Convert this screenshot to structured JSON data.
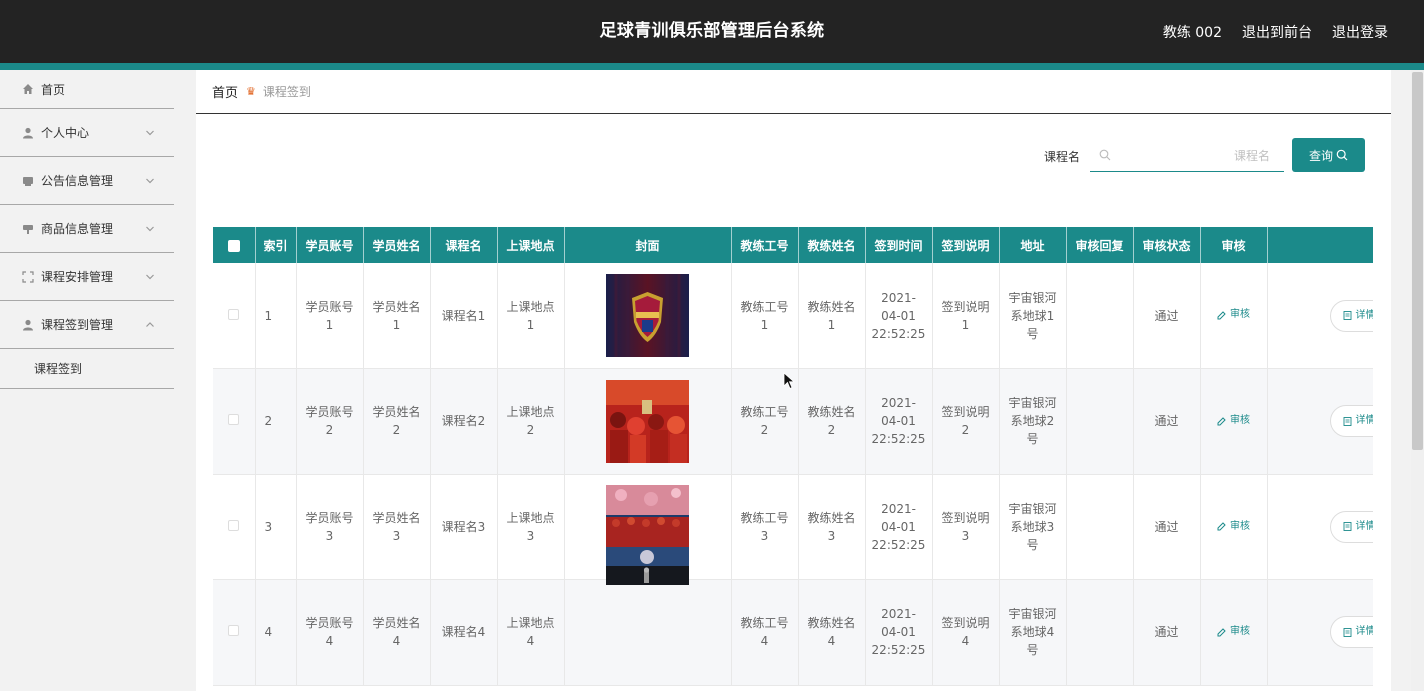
{
  "header": {
    "title": "足球青训俱乐部管理后台系统",
    "user": "教练 002",
    "to_front": "退出到前台",
    "logout": "退出登录"
  },
  "sidebar": {
    "home": "首页",
    "items": [
      {
        "label": "个人中心"
      },
      {
        "label": "公告信息管理"
      },
      {
        "label": "商品信息管理"
      },
      {
        "label": "课程安排管理"
      },
      {
        "label": "课程签到管理"
      }
    ],
    "sub_item": "课程签到"
  },
  "breadcrumb": {
    "home": "首页",
    "current": "课程签到"
  },
  "search": {
    "label": "课程名",
    "placeholder": "课程名",
    "button": "查询"
  },
  "table": {
    "headers": [
      "索引",
      "学员账号",
      "学员姓名",
      "课程名",
      "上课地点",
      "封面",
      "教练工号",
      "教练姓名",
      "签到时间",
      "签到说明",
      "地址",
      "审核回复",
      "审核状态",
      "审核"
    ],
    "audit_label": "审核",
    "detail_label": "详情",
    "rows": [
      {
        "idx": "1",
        "account": "学员账号1",
        "name": "学员姓名1",
        "course": "课程名1",
        "place": "上课地点1",
        "coach_id": "教练工号1",
        "coach_name": "教练姓名1",
        "time": "2021-04-01 22:52:25",
        "note": "签到说明1",
        "addr": "宇宙银河系地球1号",
        "reply": "",
        "status": "通过"
      },
      {
        "idx": "2",
        "account": "学员账号2",
        "name": "学员姓名2",
        "course": "课程名2",
        "place": "上课地点2",
        "coach_id": "教练工号2",
        "coach_name": "教练姓名2",
        "time": "2021-04-01 22:52:25",
        "note": "签到说明2",
        "addr": "宇宙银河系地球2号",
        "reply": "",
        "status": "通过"
      },
      {
        "idx": "3",
        "account": "学员账号3",
        "name": "学员姓名3",
        "course": "课程名3",
        "place": "上课地点3",
        "coach_id": "教练工号3",
        "coach_name": "教练姓名3",
        "time": "2021-04-01 22:52:25",
        "note": "签到说明3",
        "addr": "宇宙银河系地球3号",
        "reply": "",
        "status": "通过"
      },
      {
        "idx": "4",
        "account": "学员账号4",
        "name": "学员姓名4",
        "course": "课程名4",
        "place": "上课地点4",
        "coach_id": "教练工号4",
        "coach_name": "教练姓名4",
        "time": "2021-04-01 22:52:25",
        "note": "签到说明4",
        "addr": "宇宙银河系地球4号",
        "reply": "",
        "status": "通过"
      }
    ]
  },
  "colors": {
    "accent": "#1b8a8a",
    "topbar": "#232323"
  }
}
